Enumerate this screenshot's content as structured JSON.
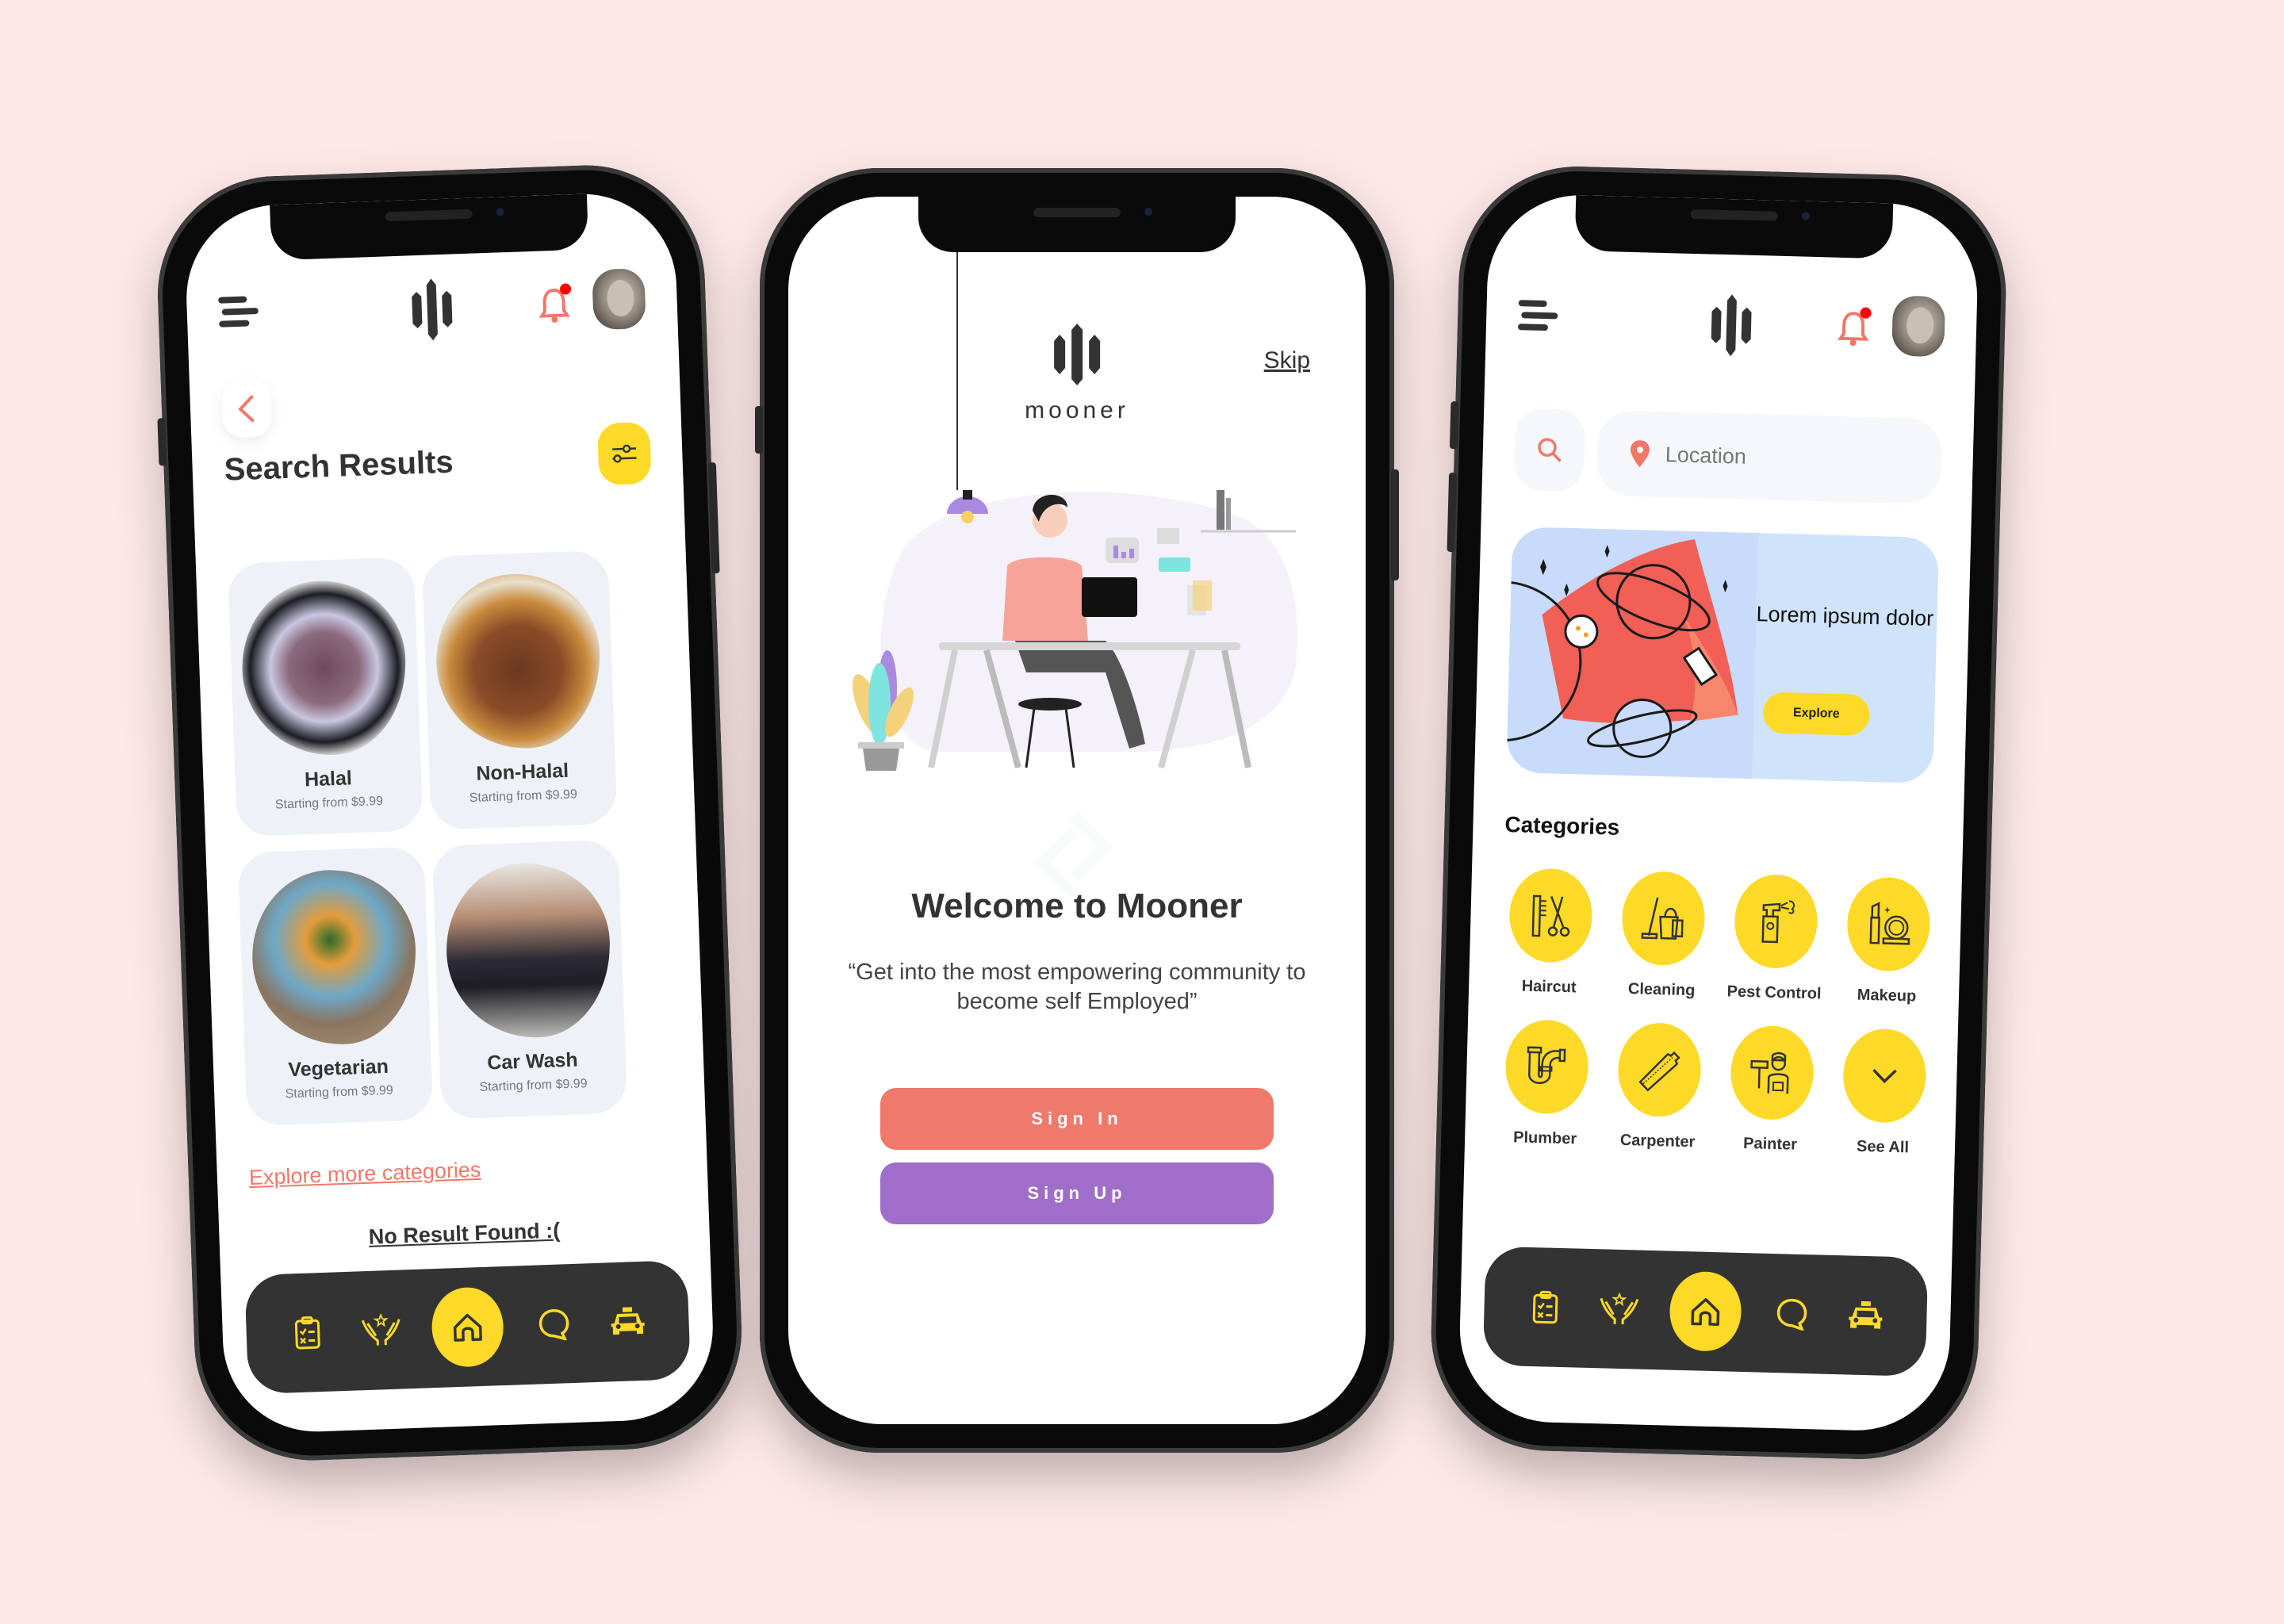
{
  "colors": {
    "background": "#fde8e7",
    "accent_yellow": "#fdd928",
    "coral": "#ef796b",
    "purple": "#9f6ec8",
    "dark": "#333333",
    "notification_dot": "#ff0000"
  },
  "search_results_screen": {
    "header": {
      "menu_icon": "hamburger-icon",
      "logo_icon": "mooner-logo-mark",
      "notification_icon": "bell-icon",
      "avatar": "user-avatar"
    },
    "back_icon": "chevron-left-icon",
    "title": "Search Results",
    "filter_icon": "sliders-icon",
    "results": [
      {
        "name": "Halal",
        "price": "Starting from $9.99"
      },
      {
        "name": "Non-Halal",
        "price": "Starting from $9.99"
      },
      {
        "name": "Vegetarian",
        "price": "Starting from $9.99"
      },
      {
        "name": "Car Wash",
        "price": "Starting from $9.99"
      }
    ],
    "explore_link": "Explore more categories",
    "no_result": "No Result Found :("
  },
  "welcome_screen": {
    "logo_word": "mooner",
    "skip": "Skip",
    "title": "Welcome to Mooner",
    "subtitle": "“Get  into the most empowering community to become self Employed”",
    "sign_in": "Sign In",
    "sign_up": "Sign Up"
  },
  "home_screen": {
    "location_placeholder": "Location",
    "banner": {
      "title": "Lorem ipsum dolor",
      "button": "Explore"
    },
    "categories_title": "Categories",
    "categories": [
      {
        "label": "Haircut",
        "icon": "comb-scissors-icon"
      },
      {
        "label": "Cleaning",
        "icon": "mop-bucket-icon"
      },
      {
        "label": "Pest Control",
        "icon": "spray-bottle-icon"
      },
      {
        "label": "Makeup",
        "icon": "lipstick-compact-icon"
      },
      {
        "label": "Plumber",
        "icon": "pipe-icon"
      },
      {
        "label": "Carpenter",
        "icon": "saw-icon"
      },
      {
        "label": "Painter",
        "icon": "painter-icon"
      },
      {
        "label": "See All",
        "icon": "chevron-down-icon"
      }
    ]
  },
  "bottom_nav": {
    "items": [
      {
        "icon": "clipboard-checklist-icon"
      },
      {
        "icon": "caring-hands-icon"
      },
      {
        "icon": "home-icon",
        "active": true
      },
      {
        "icon": "chat-bubble-icon"
      },
      {
        "icon": "taxi-icon"
      }
    ]
  }
}
